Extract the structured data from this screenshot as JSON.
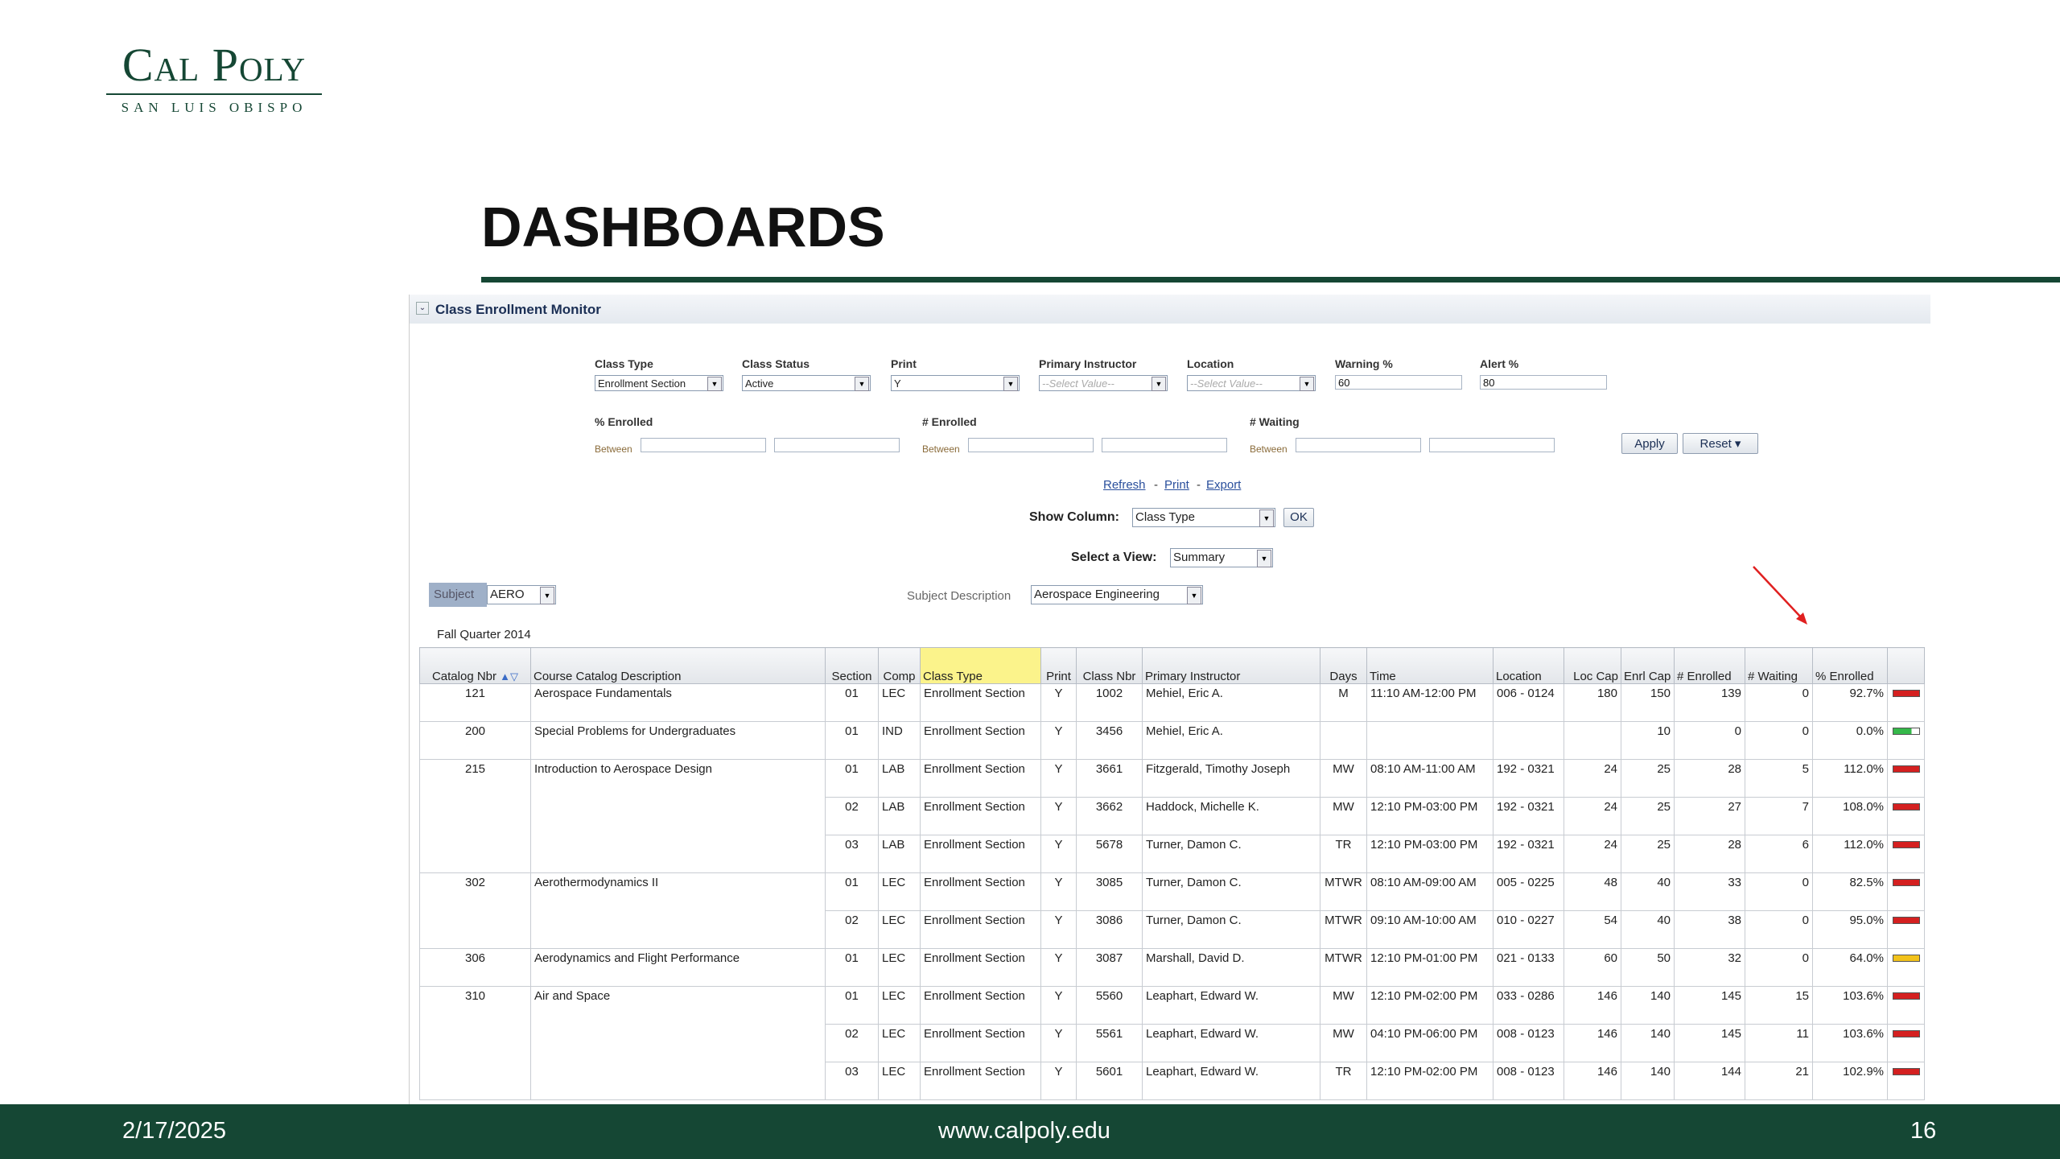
{
  "logo": {
    "main": "Cal Poly",
    "sub": "SAN LUIS OBISPO"
  },
  "slide": {
    "title": "DASHBOARDS"
  },
  "footer": {
    "date": "2/17/2025",
    "url": "www.calpoly.edu",
    "page": "16"
  },
  "panel": {
    "title": "Class Enrollment Monitor",
    "filters": {
      "class_type": {
        "label": "Class Type",
        "value": "Enrollment Section"
      },
      "class_status": {
        "label": "Class Status",
        "value": "Active"
      },
      "print": {
        "label": "Print",
        "value": "Y"
      },
      "primary_instructor": {
        "label": "Primary Instructor",
        "value": "--Select Value--"
      },
      "location": {
        "label": "Location",
        "value": "--Select Value--"
      },
      "warning": {
        "label": "Warning %",
        "value": "60"
      },
      "alert": {
        "label": "Alert %",
        "value": "80"
      },
      "pct_enrolled": {
        "label": "% Enrolled"
      },
      "num_enrolled": {
        "label": "# Enrolled"
      },
      "num_waiting": {
        "label": "# Waiting"
      },
      "between": "Between"
    },
    "buttons": {
      "apply": "Apply",
      "reset": "Reset ▾",
      "ok": "OK"
    },
    "links": {
      "refresh": "Refresh",
      "print": "Print",
      "export": "Export"
    },
    "show_column": {
      "label": "Show Column:",
      "value": "Class Type"
    },
    "select_view": {
      "label": "Select a View:",
      "value": "Summary"
    },
    "subject": {
      "label": "Subject",
      "value": "AERO"
    },
    "subject_description": {
      "label": "Subject Description",
      "value": "Aerospace Engineering"
    },
    "term": "Fall Quarter 2014",
    "table": {
      "headers": {
        "catalog": "Catalog Nbr",
        "description": "Course Catalog Description",
        "section": "Section",
        "comp": "Comp",
        "class_type": "Class Type",
        "print": "Print",
        "class_nbr": "Class Nbr",
        "instructor": "Primary Instructor",
        "days": "Days",
        "time": "Time",
        "location": "Location",
        "loc_cap": "Loc Cap",
        "enrl_cap": "Enrl Cap",
        "enrolled": "# Enrolled",
        "waiting": "# Waiting",
        "pct": "% Enrolled"
      },
      "rows": [
        {
          "catalog": "121",
          "desc": "Aerospace Fundamentals",
          "section": "01",
          "comp": "LEC",
          "type": "Enrollment Section",
          "print": "Y",
          "nbr": "1002",
          "instr": "Mehiel, Eric A.",
          "days": "M",
          "time": "11:10 AM-12:00 PM",
          "loc": "006 - 0124",
          "loccap": "180",
          "enrlcap": "150",
          "enrolled": "139",
          "waiting": "0",
          "pct": "92.7%",
          "status": "alert",
          "fill": 1.0
        },
        {
          "catalog": "200",
          "desc": "Special Problems for Undergraduates",
          "section": "01",
          "comp": "IND",
          "type": "Enrollment Section",
          "print": "Y",
          "nbr": "3456",
          "instr": "Mehiel, Eric A.",
          "days": "",
          "time": "",
          "loc": "",
          "loccap": "",
          "enrlcap": "10",
          "enrolled": "0",
          "waiting": "0",
          "pct": "0.0%",
          "status": "ok",
          "fill": 0.7
        },
        {
          "catalog": "215",
          "desc": "Introduction to Aerospace Design",
          "section": "01",
          "comp": "LAB",
          "type": "Enrollment Section",
          "print": "Y",
          "nbr": "3661",
          "instr": "Fitzgerald, Timothy Joseph",
          "days": "MW",
          "time": "08:10 AM-11:00 AM",
          "loc": "192 - 0321",
          "loccap": "24",
          "enrlcap": "25",
          "enrolled": "28",
          "waiting": "5",
          "pct": "112.0%",
          "status": "alert",
          "fill": 1.0
        },
        {
          "catalog": "",
          "desc": "",
          "section": "02",
          "comp": "LAB",
          "type": "Enrollment Section",
          "print": "Y",
          "nbr": "3662",
          "instr": "Haddock, Michelle K.",
          "days": "MW",
          "time": "12:10 PM-03:00 PM",
          "loc": "192 - 0321",
          "loccap": "24",
          "enrlcap": "25",
          "enrolled": "27",
          "waiting": "7",
          "pct": "108.0%",
          "status": "alert",
          "fill": 1.0
        },
        {
          "catalog": "",
          "desc": "",
          "section": "03",
          "comp": "LAB",
          "type": "Enrollment Section",
          "print": "Y",
          "nbr": "5678",
          "instr": "Turner, Damon C.",
          "days": "TR",
          "time": "12:10 PM-03:00 PM",
          "loc": "192 - 0321",
          "loccap": "24",
          "enrlcap": "25",
          "enrolled": "28",
          "waiting": "6",
          "pct": "112.0%",
          "status": "alert",
          "fill": 1.0
        },
        {
          "catalog": "302",
          "desc": "Aerothermodynamics II",
          "section": "01",
          "comp": "LEC",
          "type": "Enrollment Section",
          "print": "Y",
          "nbr": "3085",
          "instr": "Turner, Damon C.",
          "days": "MTWR",
          "time": "08:10 AM-09:00 AM",
          "loc": "005 - 0225",
          "loccap": "48",
          "enrlcap": "40",
          "enrolled": "33",
          "waiting": "0",
          "pct": "82.5%",
          "status": "alert",
          "fill": 1.0
        },
        {
          "catalog": "",
          "desc": "",
          "section": "02",
          "comp": "LEC",
          "type": "Enrollment Section",
          "print": "Y",
          "nbr": "3086",
          "instr": "Turner, Damon C.",
          "days": "MTWR",
          "time": "09:10 AM-10:00 AM",
          "loc": "010 - 0227",
          "loccap": "54",
          "enrlcap": "40",
          "enrolled": "38",
          "waiting": "0",
          "pct": "95.0%",
          "status": "alert",
          "fill": 1.0
        },
        {
          "catalog": "306",
          "desc": "Aerodynamics and Flight Performance",
          "section": "01",
          "comp": "LEC",
          "type": "Enrollment Section",
          "print": "Y",
          "nbr": "3087",
          "instr": "Marshall, David D.",
          "days": "MTWR",
          "time": "12:10 PM-01:00 PM",
          "loc": "021 - 0133",
          "loccap": "60",
          "enrlcap": "50",
          "enrolled": "32",
          "waiting": "0",
          "pct": "64.0%",
          "status": "warning",
          "fill": 1.0
        },
        {
          "catalog": "310",
          "desc": "Air and Space",
          "section": "01",
          "comp": "LEC",
          "type": "Enrollment Section",
          "print": "Y",
          "nbr": "5560",
          "instr": "Leaphart, Edward W.",
          "days": "MW",
          "time": "12:10 PM-02:00 PM",
          "loc": "033 - 0286",
          "loccap": "146",
          "enrlcap": "140",
          "enrolled": "145",
          "waiting": "15",
          "pct": "103.6%",
          "status": "alert",
          "fill": 1.0
        },
        {
          "catalog": "",
          "desc": "",
          "section": "02",
          "comp": "LEC",
          "type": "Enrollment Section",
          "print": "Y",
          "nbr": "5561",
          "instr": "Leaphart, Edward W.",
          "days": "MW",
          "time": "04:10 PM-06:00 PM",
          "loc": "008 - 0123",
          "loccap": "146",
          "enrlcap": "140",
          "enrolled": "145",
          "waiting": "11",
          "pct": "103.6%",
          "status": "alert",
          "fill": 1.0
        },
        {
          "catalog": "",
          "desc": "",
          "section": "03",
          "comp": "LEC",
          "type": "Enrollment Section",
          "print": "Y",
          "nbr": "5601",
          "instr": "Leaphart, Edward W.",
          "days": "TR",
          "time": "12:10 PM-02:00 PM",
          "loc": "008 - 0123",
          "loccap": "146",
          "enrlcap": "140",
          "enrolled": "144",
          "waiting": "21",
          "pct": "102.9%",
          "status": "alert",
          "fill": 1.0
        }
      ]
    },
    "status_colors": {
      "alert": "#d42020",
      "warning": "#f2c21b",
      "ok": "#35b84a"
    }
  }
}
